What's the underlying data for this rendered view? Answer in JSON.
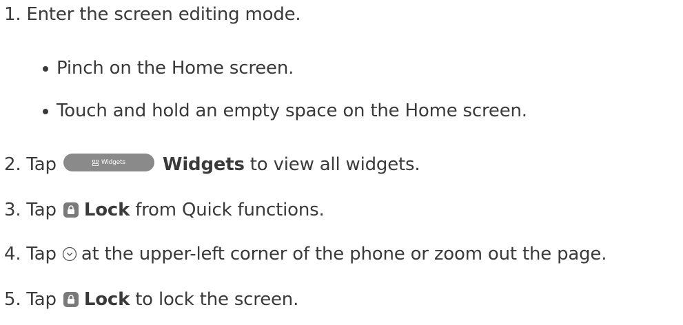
{
  "steps": [
    {
      "num": "1.",
      "text": "Enter the screen editing mode."
    },
    {
      "num": "2.",
      "pre": "Tap",
      "button_label": "Widgets",
      "bold": "Widgets",
      "post": "to view all widgets."
    },
    {
      "num": "3.",
      "pre": "Tap",
      "bold": "Lock",
      "post": "from Quick functions."
    },
    {
      "num": "4.",
      "pre": "Tap",
      "post": "at the upper-left corner of the phone or zoom out the page."
    },
    {
      "num": "5.",
      "pre": "Tap",
      "bold": "Lock",
      "post": "to lock the screen."
    }
  ],
  "substeps": [
    "Pinch on the Home screen.",
    "Touch and hold an empty space on the Home screen."
  ],
  "icons": {
    "widgets_button": "widgets-grid-icon",
    "lock": "lock-icon",
    "collapse": "chevron-down-circle-icon"
  },
  "colors": {
    "text": "#3a3a3a",
    "widgets_button_bg": "#8a8a8a",
    "lock_icon_bg": "#7a7a7a"
  }
}
